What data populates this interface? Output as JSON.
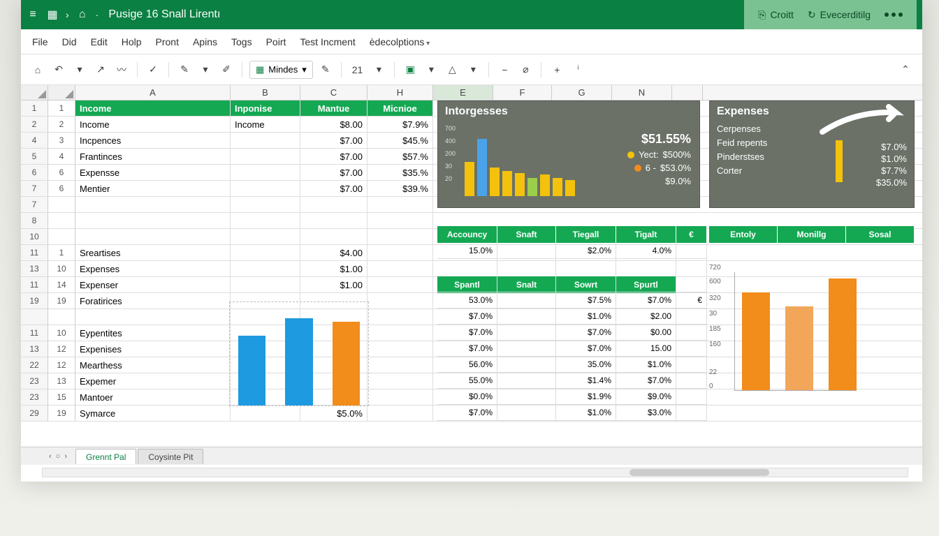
{
  "titlebar": {
    "title": "Pusige 16 Snall Lirentı",
    "right_a": "Croitt",
    "right_b": "Evecerditilg"
  },
  "menus": [
    "File",
    "Did",
    "Edit",
    "Holp",
    "Pront",
    "Apins",
    "Togs",
    "Poirt",
    "Test Incment",
    "èdecolptions"
  ],
  "toolbar": {
    "combo": "Mindes",
    "zoom": "21"
  },
  "columns": [
    "A",
    "B",
    "C",
    "H",
    "E",
    "F",
    "G",
    "N"
  ],
  "header_row": {
    "A": "Income",
    "B": "Inponise",
    "C": "Mantue",
    "H": "Micnioe"
  },
  "rows_top": [
    {
      "n1": "1",
      "n2": "1",
      "A": "Income",
      "B": "Inponise",
      "C": "Mantue",
      "H": "Micnioe",
      "hdr": true
    },
    {
      "n1": "2",
      "n2": "2",
      "A": "Income",
      "B": "Income",
      "C": "$8.00",
      "H": "$7.9%"
    },
    {
      "n1": "4",
      "n2": "3",
      "A": "Incpences",
      "B": "",
      "C": "$7.00",
      "H": "$45.%"
    },
    {
      "n1": "5",
      "n2": "4",
      "A": "Frantinces",
      "B": "",
      "C": "$7.00",
      "H": "$57.%"
    },
    {
      "n1": "6",
      "n2": "6",
      "A": "Expensse",
      "B": "",
      "C": "$7.00",
      "H": "$35.%"
    },
    {
      "n1": "7",
      "n2": "6",
      "A": "Mentier",
      "B": "",
      "C": "$7.00",
      "H": "$39.%"
    }
  ],
  "rows_gap": [
    {
      "n1": "7"
    },
    {
      "n1": "8"
    },
    {
      "n1": "10"
    }
  ],
  "rows_mid": [
    {
      "n1": "11",
      "n2": "1",
      "A": "Sreartises",
      "C": "$4.00"
    },
    {
      "n1": "13",
      "n2": "10",
      "A": "Expenses",
      "C": "$1.00"
    },
    {
      "n1": "11",
      "n2": "14",
      "A": "Expenser",
      "C": "$1.00"
    },
    {
      "n1": "19",
      "n2": "19",
      "A": "Foratirices",
      "C": ""
    }
  ],
  "rows_bot": [
    {
      "n1": "11",
      "n2": "10",
      "A": "Eypentites"
    },
    {
      "n1": "13",
      "n2": "12",
      "A": "Expenises"
    },
    {
      "n1": "22",
      "n2": "12",
      "A": "Mearthess"
    },
    {
      "n1": "23",
      "n2": "13",
      "A": "Expemer"
    },
    {
      "n1": "23",
      "n2": "15",
      "A": "Mantoer"
    },
    {
      "n1": "29",
      "n2": "19",
      "A": "Symarce",
      "C": "$5.0%"
    }
  ],
  "panel1": {
    "title": "Intorgesses",
    "yticks": [
      "700",
      "400",
      "200",
      "30",
      "20"
    ],
    "legend_big": "$51.55%",
    "legend": [
      {
        "color": "#f4c20d",
        "label": "Yect:",
        "val": "$500%"
      },
      {
        "color": "#f28c1a",
        "label": "6 -",
        "val": "$53.0%"
      },
      {
        "color_blank": true,
        "label": "",
        "val": "$9.0%"
      }
    ]
  },
  "panel2": {
    "title": "Expenses",
    "cats": [
      "Cerpenses",
      "Feid repents",
      "Pinderstses",
      "Corter"
    ],
    "vals": [
      "$7.0%",
      "$1.0%",
      "$7.7%",
      "$35.0%"
    ],
    "dots": [
      "#f28c1a",
      "#6bbf4b",
      "#f28c1a",
      ""
    ]
  },
  "subheaders1": [
    "Accouncy",
    "Snaft",
    "Tiegall",
    "Tigalt",
    "€"
  ],
  "subheaders2": [
    "Entoly",
    "Monillg",
    "Sosal"
  ],
  "subheaders3": [
    "Spantl",
    "Snalt",
    "Sowrt",
    "Spurtl"
  ],
  "right_rows": [
    {
      "E": "15.0%",
      "F": "",
      "G": "$2.0%",
      "N": "4.0%"
    },
    {
      "E": "",
      "F": "",
      "G": "",
      "N": ""
    },
    {
      "E": "53.0%",
      "F": "",
      "G": "$7.5%",
      "N": "$7.0%",
      "sp": "€"
    },
    {
      "E": "$7.0%",
      "F": "",
      "G": "$1.0%",
      "N": "$2.00"
    },
    {
      "E": "$7.0%",
      "F": "",
      "G": "$7.0%",
      "N": "$0.00"
    },
    {
      "E": "$7.0%",
      "F": "",
      "G": "$7.0%",
      "N": "15.00"
    },
    {
      "E": "56.0%",
      "F": "",
      "G": "35.0%",
      "N": "$1.0%"
    },
    {
      "E": "55.0%",
      "F": "",
      "G": "$1.4%",
      "N": "$7.0%"
    },
    {
      "E": "$0.0%",
      "F": "",
      "G": "$1.9%",
      "N": "$9.0%"
    },
    {
      "E": "$7.0%",
      "F": "",
      "G": "$1.0%",
      "N": "$3.0%"
    }
  ],
  "chart_data": [
    {
      "type": "bar",
      "title": "Intorgesses",
      "y_ticks": [
        700,
        400,
        200,
        30,
        20
      ],
      "values": [
        380,
        640,
        320,
        280,
        260,
        200,
        240,
        200,
        180
      ],
      "colors": [
        "#f4c20d",
        "#4aa3e8",
        "#f4c20d",
        "#f4c20d",
        "#f4c20d",
        "#9bce4a",
        "#f4c20d",
        "#f4c20d",
        "#f4c20d"
      ],
      "legend": [
        {
          "name": "Yect",
          "value": "$500%",
          "color": "#f4c20d"
        },
        {
          "name": "6",
          "value": "$53.0%",
          "color": "#f28c1a"
        }
      ],
      "big_value": "$51.55%",
      "extra_value": "$9.0%"
    },
    {
      "type": "bar",
      "location": "embedded-left",
      "values": [
        110,
        130,
        125
      ],
      "colors": [
        "#1e9ae0",
        "#1e9ae0",
        "#f28c1a"
      ]
    },
    {
      "type": "bar",
      "location": "embedded-right",
      "y_ticks": [
        720,
        600,
        320,
        30,
        185,
        160,
        22,
        0
      ],
      "values": [
        540,
        480,
        620
      ],
      "colors": [
        "#f28c1a",
        "#f2a65a",
        "#f28c1a"
      ]
    }
  ],
  "tabs": {
    "active": "Grennt Pal",
    "other": "Coysinte Pit"
  }
}
